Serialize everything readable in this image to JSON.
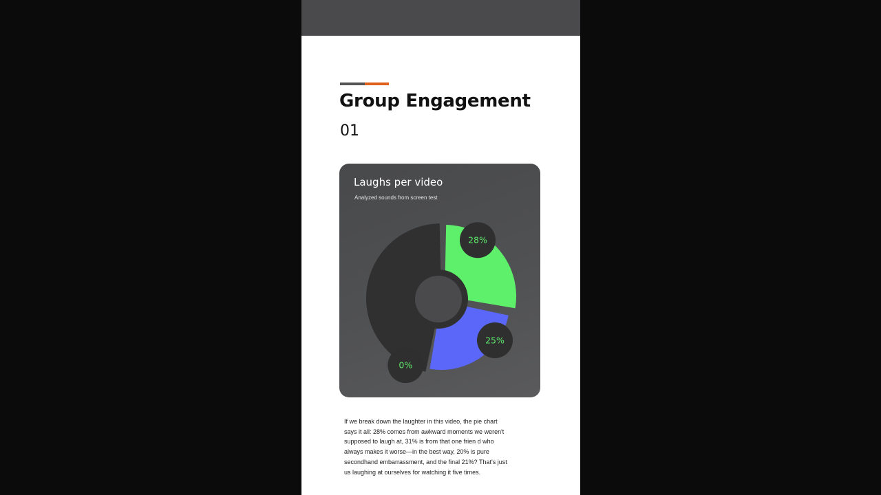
{
  "colors": {
    "background": "#0b0b0b",
    "topbar": "#4a4a4d",
    "accent_dark": "#555555",
    "accent_orange": "#e0601c",
    "dark_slice": "#303030",
    "inner_circle": "#4a4a4c",
    "bubble": "#2f2f2f",
    "label_green": "#5de86a"
  },
  "page": {
    "heading": "Group Engagement",
    "number": "01",
    "paragraph": "If we break down the laughter in this video, the pie chart\nsays it all: 28% comes from awkward moments we weren't\nsupposed to laugh at, 31% is from that one frien  d who\nalways makes it worse—in the best way, 20% is pure\nsecondhand embarrassment, and the final 21%? That's just\nus laughing at ourselves for watching it five times."
  },
  "chart_data": {
    "type": "pie",
    "title": "Laughs per video",
    "subtitle": "Analyzed sounds from screen test",
    "slices": [
      {
        "label": "28%",
        "value": 28,
        "color": "#5ef06a"
      },
      {
        "label": "25%",
        "value": 25,
        "color": "#5b67f9"
      },
      {
        "label": "0%",
        "value": 47,
        "color": "#303030"
      }
    ]
  }
}
